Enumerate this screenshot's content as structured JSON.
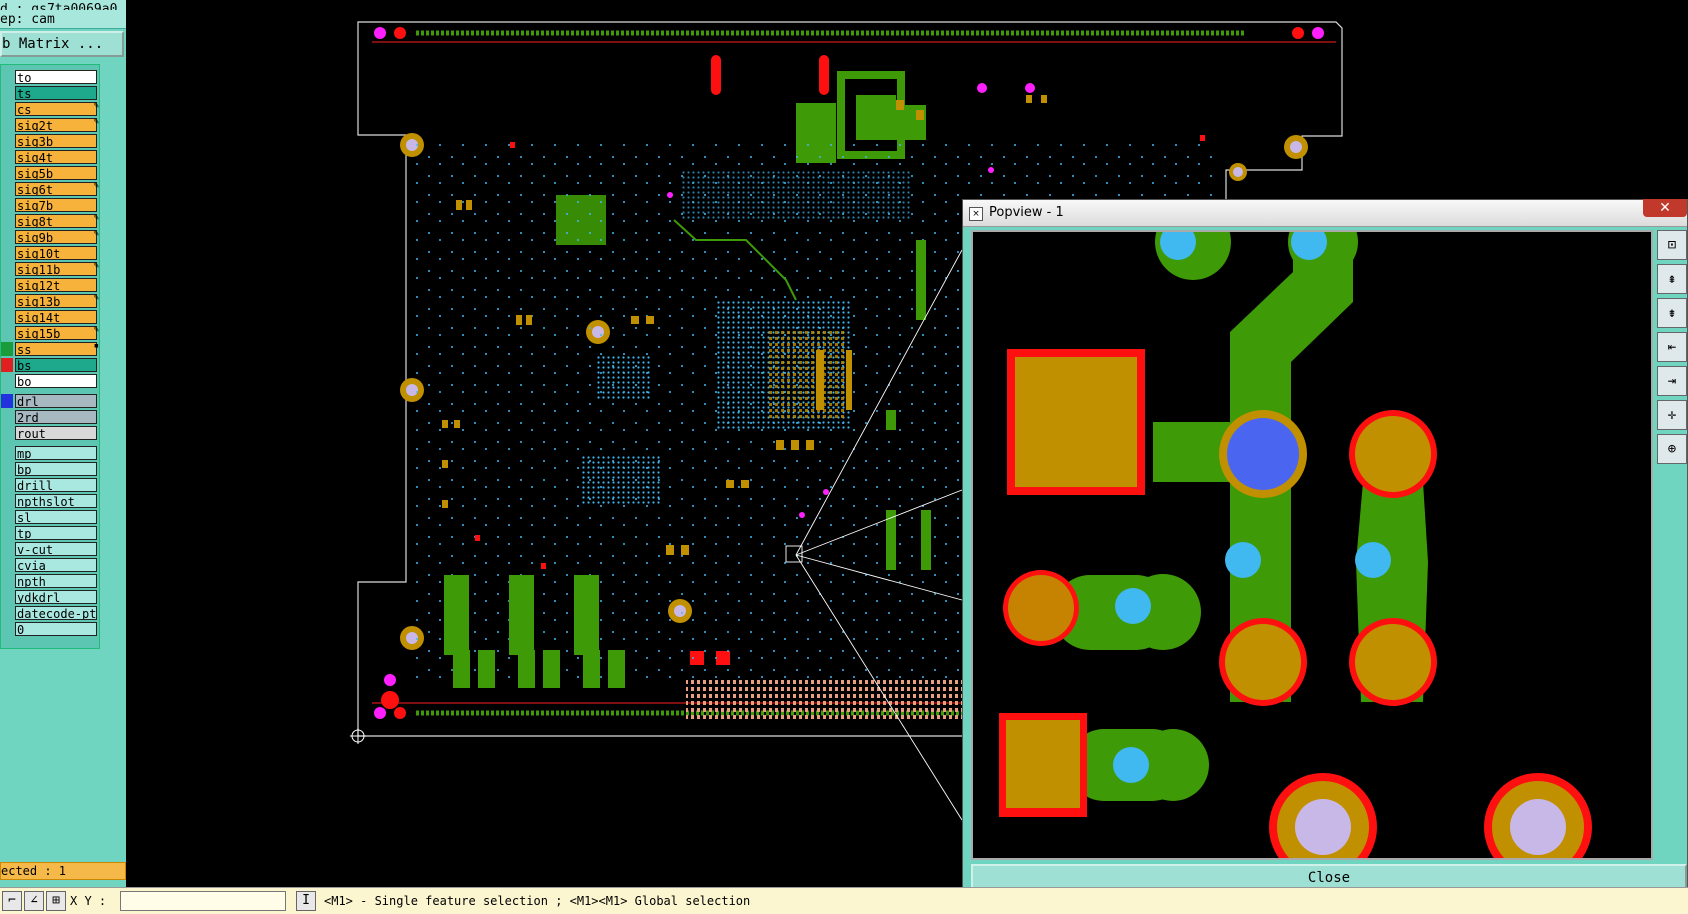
{
  "header": {
    "job_line": "d : gs7ta0069a0",
    "step_line": "ep: cam",
    "matrix_button": "b Matrix ..."
  },
  "layers": [
    {
      "name": "to",
      "bg": "#ffffff",
      "marker": ""
    },
    {
      "name": "ts",
      "bg": "#1ea88c",
      "marker": ""
    },
    {
      "name": "cs",
      "bg": "#f7b23b",
      "marker": "",
      "icon": "✎"
    },
    {
      "name": "sig2t",
      "bg": "#f7b23b",
      "marker": "",
      "icon": "✎"
    },
    {
      "name": "sig3b",
      "bg": "#f7b23b",
      "marker": ""
    },
    {
      "name": "sig4t",
      "bg": "#f7b23b",
      "marker": ""
    },
    {
      "name": "sig5b",
      "bg": "#f7b23b",
      "marker": ""
    },
    {
      "name": "sig6t",
      "bg": "#f7b23b",
      "marker": "",
      "icon": "✎"
    },
    {
      "name": "sig7b",
      "bg": "#f7b23b",
      "marker": ""
    },
    {
      "name": "sig8t",
      "bg": "#f7b23b",
      "marker": "",
      "icon": "✎"
    },
    {
      "name": "sig9b",
      "bg": "#f7b23b",
      "marker": "",
      "icon": "✎"
    },
    {
      "name": "sig10t",
      "bg": "#f7b23b",
      "marker": ""
    },
    {
      "name": "sig11b",
      "bg": "#f7b23b",
      "marker": "",
      "icon": "✎"
    },
    {
      "name": "sig12t",
      "bg": "#f7b23b",
      "marker": ""
    },
    {
      "name": "sig13b",
      "bg": "#f7b23b",
      "marker": "",
      "icon": "✎"
    },
    {
      "name": "sig14t",
      "bg": "#f7b23b",
      "marker": ""
    },
    {
      "name": "sig15b",
      "bg": "#f7b23b",
      "marker": "",
      "icon": "✎"
    },
    {
      "name": "ss",
      "bg": "#f7b23b",
      "marker": "#1a9c3c",
      "icon": "▪"
    },
    {
      "name": "bs",
      "bg": "#1ea88c",
      "marker": "#e02020"
    },
    {
      "name": "bo",
      "bg": "#ffffff",
      "marker": ""
    },
    {
      "name": "drl",
      "bg": "#a8b8c0",
      "marker": "#2233dd",
      "gap": true
    },
    {
      "name": "2rd",
      "bg": "#a8b8c0",
      "marker": ""
    },
    {
      "name": "rout",
      "bg": "#d8d8d8",
      "marker": ""
    },
    {
      "name": "mp",
      "bg": "#a8e8e0",
      "marker": "",
      "gap": true
    },
    {
      "name": "bp",
      "bg": "#a8e8e0",
      "marker": ""
    },
    {
      "name": "drill",
      "bg": "#a8e8e0",
      "marker": ""
    },
    {
      "name": "npthslot",
      "bg": "#a8e8e0",
      "marker": ""
    },
    {
      "name": "sl",
      "bg": "#a8e8e0",
      "marker": ""
    },
    {
      "name": "tp",
      "bg": "#a8e8e0",
      "marker": ""
    },
    {
      "name": "v-cut",
      "bg": "#a8e8e0",
      "marker": ""
    },
    {
      "name": "cvia",
      "bg": "#a8e8e0",
      "marker": ""
    },
    {
      "name": "npth",
      "bg": "#a8e8e0",
      "marker": ""
    },
    {
      "name": "ydkdrl",
      "bg": "#a8e8e0",
      "marker": ""
    },
    {
      "name": "datecode-ptc",
      "bg": "#a8e8e0",
      "marker": ""
    },
    {
      "name": "0",
      "bg": "#a8e8e0",
      "marker": ""
    }
  ],
  "status": {
    "selected": "ected : 1"
  },
  "bottom": {
    "xy_label": "X Y :",
    "xy_value": "",
    "hint": "<M1> - Single feature selection ; <M1><M1> Global selection"
  },
  "popview": {
    "title": "Popview - 1",
    "close_x": "✕",
    "close_button": "Close",
    "tools": [
      "zoom-home-icon",
      "page-up-icon",
      "page-down-icon",
      "page-left-icon",
      "page-right-icon",
      "zoom-fit-icon",
      "zoom-center-icon"
    ]
  },
  "colors": {
    "copper": "#3e9a06",
    "pad": "#c09000",
    "soldermask": "#ff1010",
    "drill": "#40b8f0",
    "via_blue": "#4a66f0",
    "profile": "#e0e0e0"
  }
}
